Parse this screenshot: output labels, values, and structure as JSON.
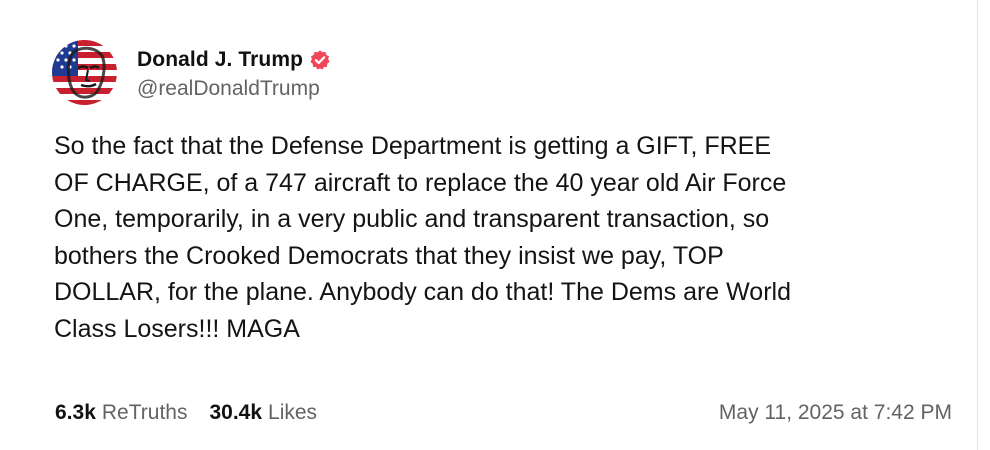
{
  "author": {
    "display_name": "Donald J. Trump",
    "handle": "@realDonaldTrump",
    "verified": true,
    "avatar_icon": "profile-avatar",
    "verified_badge_color": "#f0475b"
  },
  "post": {
    "lines": [
      "So the fact that the Defense Department is getting a GIFT, FREE",
      "OF CHARGE, of a 747 aircraft to replace the 40 year old Air Force",
      "One, temporarily, in a very public and transparent transaction, so",
      "bothers the Crooked Democrats that they insist we pay, TOP",
      "DOLLAR, for the plane. Anybody can do that! The Dems are World",
      "Class Losers!!! MAGA"
    ]
  },
  "stats": {
    "retruths_count": "6.3k",
    "retruths_label": "ReTruths",
    "likes_count": "30.4k",
    "likes_label": "Likes"
  },
  "timestamp": "May 11, 2025 at 7:42 PM"
}
